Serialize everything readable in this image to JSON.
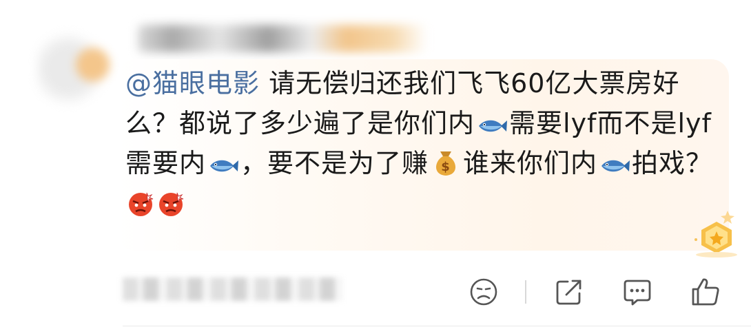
{
  "comment": {
    "mention": "@猫眼电影",
    "text_1": " 请无偿归还我们飞飞60亿大票房好么？都说了多少遍了是你们内",
    "text_2": "需要lyf而不是lyf需要内",
    "text_3": "，要不是为了赚",
    "text_4": "谁来你们内",
    "text_5": "拍戏？",
    "emojis": [
      "fish-emoji",
      "money-bag-emoji",
      "angry-face-emoji"
    ]
  },
  "actions": [
    "dislike-icon",
    "share-icon",
    "comment-icon",
    "like-icon"
  ],
  "colors": {
    "mention": "#4a6fa0",
    "text": "#1a1a1a",
    "bubble": "#fff6ee",
    "icon": "#555555"
  }
}
